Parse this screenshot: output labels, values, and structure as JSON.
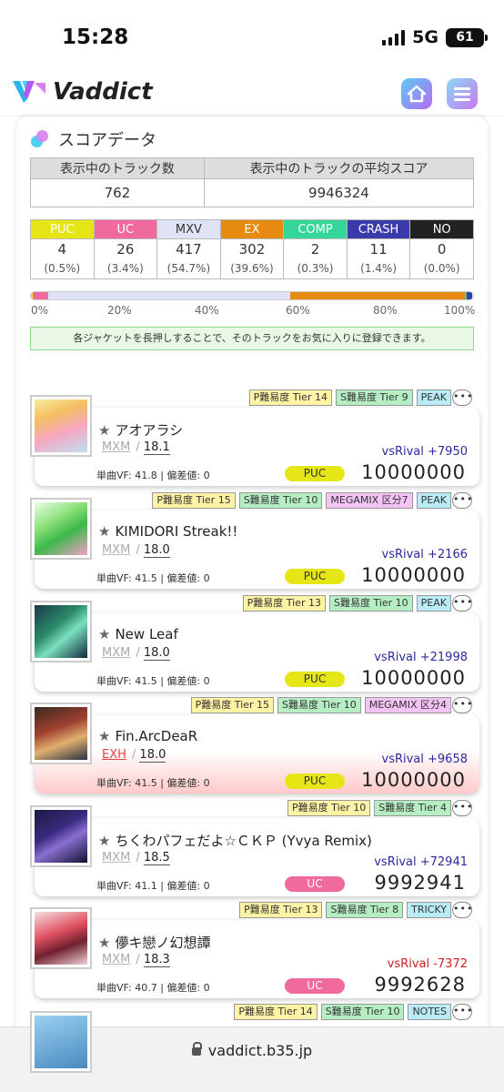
{
  "status": {
    "time": "15:28",
    "network": "5G",
    "battery": "61"
  },
  "app": {
    "name": "Vaddict"
  },
  "section": {
    "title": "スコアデータ"
  },
  "summary": {
    "headers": [
      "表示中のトラック数",
      "表示中のトラックの平均スコア"
    ],
    "values": [
      "762",
      "9946324"
    ]
  },
  "ranks": [
    {
      "label": "PUC",
      "count": "4",
      "pct": "(0.5%)",
      "color": "#e6e617",
      "fraction": 0.005
    },
    {
      "label": "UC",
      "count": "26",
      "pct": "(3.4%)",
      "color": "#f06a9e",
      "fraction": 0.034
    },
    {
      "label": "MXV",
      "count": "417",
      "pct": "(54.7%)",
      "color": "#dfe3f5",
      "fraction": 0.547
    },
    {
      "label": "EX",
      "count": "302",
      "pct": "(39.6%)",
      "color": "#e68a10",
      "fraction": 0.396
    },
    {
      "label": "COMP",
      "count": "2",
      "pct": "(0.3%)",
      "color": "#34d69a",
      "fraction": 0.003
    },
    {
      "label": "CRASH",
      "count": "11",
      "pct": "(1.4%)",
      "color": "#3a3aaa",
      "fraction": 0.014
    },
    {
      "label": "NO",
      "count": "0",
      "pct": "(0.0%)",
      "color": "#222222",
      "fraction": 0.0
    }
  ],
  "scale": [
    "0%",
    "20%",
    "40%",
    "60%",
    "80%",
    "100%"
  ],
  "notice": "各ジャケットを長押しすることで、そのトラックをお気に入りに登録できます。",
  "more_label": "•••",
  "tracks": [
    {
      "title": "アオアラシ",
      "diff": "MXM",
      "level": "18.1",
      "tags": [
        {
          "t": "p",
          "text": "P難易度 Tier 14"
        },
        {
          "t": "s",
          "text": "S難易度 Tier 9"
        },
        {
          "t": "k",
          "text": "PEAK"
        }
      ],
      "vs": "vsRival +7950",
      "vs_sign": "pos",
      "vf": "単曲VF: 41.8 | 偏差値: 0",
      "clear": "PUC",
      "score": "10000000",
      "art": "linear-gradient(160deg,#f9e9a0 0%,#f4c060 30%,#f6a6c0 60%,#c0e0f0 100%)"
    },
    {
      "title": "KIMIDORI Streak!!",
      "diff": "MXM",
      "level": "18.0",
      "tags": [
        {
          "t": "p",
          "text": "P難易度 Tier 15"
        },
        {
          "t": "s",
          "text": "S難易度 Tier 10"
        },
        {
          "t": "m",
          "text": "MEGAMIX 区分7"
        },
        {
          "t": "k",
          "text": "PEAK"
        }
      ],
      "vs": "vsRival +2166",
      "vs_sign": "pos",
      "vf": "単曲VF: 41.5 | 偏差値: 0",
      "clear": "PUC",
      "score": "10000000",
      "art": "linear-gradient(150deg,#e8ffe8 0%,#8ee07a 35%,#3cb84a 60%,#f4a0c8 100%)"
    },
    {
      "title": "New Leaf",
      "diff": "MXM",
      "level": "18.0",
      "tags": [
        {
          "t": "p",
          "text": "P難易度 Tier 13"
        },
        {
          "t": "s",
          "text": "S難易度 Tier 10"
        },
        {
          "t": "k",
          "text": "PEAK"
        }
      ],
      "vs": "vsRival +21998",
      "vs_sign": "pos",
      "vf": "単曲VF: 41.5 | 偏差値: 0",
      "clear": "PUC",
      "score": "10000000",
      "art": "linear-gradient(140deg,#1a3a4a 0%,#2c8a6a 40%,#7ae0c0 60%,#14283a 100%)"
    },
    {
      "title": "Fin.ArcDeaR",
      "diff": "EXH",
      "level": "18.0",
      "tags": [
        {
          "t": "p",
          "text": "P難易度 Tier 15"
        },
        {
          "t": "s",
          "text": "S難易度 Tier 10"
        },
        {
          "t": "m",
          "text": "MEGAMIX 区分4"
        }
      ],
      "vs": "vsRival +9658",
      "vs_sign": "pos",
      "vf": "単曲VF: 41.5 | 偏差値: 0",
      "clear": "PUC",
      "score": "10000000",
      "art": "linear-gradient(160deg,#3a2a20 0%,#a04030 40%,#e0b070 65%,#2a3040 100%)"
    },
    {
      "title": "ちくわパフェだよ☆ＣＫＰ (Yvya Remix)",
      "diff": "MXM",
      "level": "18.5",
      "tags": [
        {
          "t": "p",
          "text": "P難易度 Tier 10"
        },
        {
          "t": "s",
          "text": "S難易度 Tier 4"
        }
      ],
      "vs": "vsRival +72941",
      "vs_sign": "pos",
      "vf": "単曲VF: 41.1 | 偏差値: 0",
      "clear": "UC",
      "score": "9992941",
      "art": "linear-gradient(150deg,#1a1a40 0%,#3a2a80 40%,#8a70d0 60%,#101030 100%)"
    },
    {
      "title": "儚キ戀ノ幻想譚",
      "diff": "MXM",
      "level": "18.3",
      "tags": [
        {
          "t": "p",
          "text": "P難易度 Tier 13"
        },
        {
          "t": "s",
          "text": "S難易度 Tier 8"
        },
        {
          "t": "k",
          "text": "TRICKY"
        }
      ],
      "vs": "vsRival -7372",
      "vs_sign": "neg",
      "vf": "単曲VF: 40.7 | 偏差値: 0",
      "clear": "UC",
      "score": "9992628",
      "art": "linear-gradient(160deg,#f6e0e0 0%,#e05060 40%,#702030 65%,#f0d0d8 100%)"
    },
    {
      "title": "",
      "diff": "",
      "level": "",
      "tags": [
        {
          "t": "p",
          "text": "P難易度 Tier 14"
        },
        {
          "t": "s",
          "text": "S難易度 Tier 10"
        },
        {
          "t": "k",
          "text": "NOTES"
        }
      ],
      "vs": "",
      "vs_sign": "pos",
      "vf": "",
      "clear": "",
      "score": "",
      "art": "linear-gradient(160deg,#9ad0f0 0%,#4a8ac0 100%)"
    }
  ],
  "url": "vaddict.b35.jp"
}
